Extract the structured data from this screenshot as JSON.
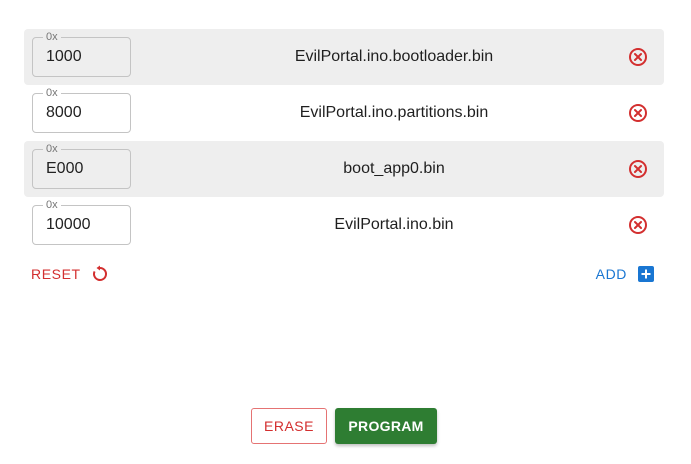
{
  "files": [
    {
      "offset_prefix": "0x",
      "offset": "1000",
      "filename": "EvilPortal.ino.bootloader.bin",
      "shaded": true
    },
    {
      "offset_prefix": "0x",
      "offset": "8000",
      "filename": "EvilPortal.ino.partitions.bin",
      "shaded": false
    },
    {
      "offset_prefix": "0x",
      "offset": "E000",
      "filename": "boot_app0.bin",
      "shaded": true
    },
    {
      "offset_prefix": "0x",
      "offset": "10000",
      "filename": "EvilPortal.ino.bin",
      "shaded": false
    }
  ],
  "actions": {
    "reset_label": "RESET",
    "add_label": "ADD",
    "erase_label": "ERASE",
    "program_label": "PROGRAM"
  },
  "colors": {
    "danger": "#d32f2f",
    "primary": "#1976d2",
    "success": "#2e7d32",
    "row_shade": "#eeeeee"
  },
  "icons": {
    "remove": "remove-circle-icon",
    "reset": "refresh-icon",
    "add": "add-box-icon"
  }
}
